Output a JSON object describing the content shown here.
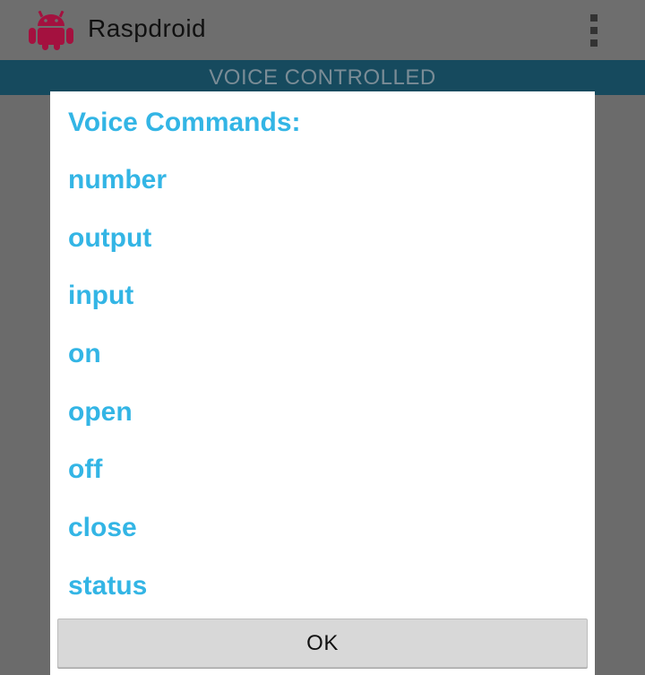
{
  "app": {
    "title": "Raspdroid",
    "icon": "android-robot-icon"
  },
  "action_bar": {
    "overflow_icon": "overflow-menu-icon"
  },
  "banner": {
    "text": "VOICE CONTROLLED"
  },
  "dialog": {
    "title": "Voice Commands:",
    "commands": [
      "number",
      "output",
      "input",
      "on",
      "open",
      "off",
      "close",
      "status"
    ],
    "ok_label": "OK"
  },
  "colors": {
    "accent": "#33b5e5",
    "banner": "#164a5e",
    "icon": "#a4113f"
  }
}
